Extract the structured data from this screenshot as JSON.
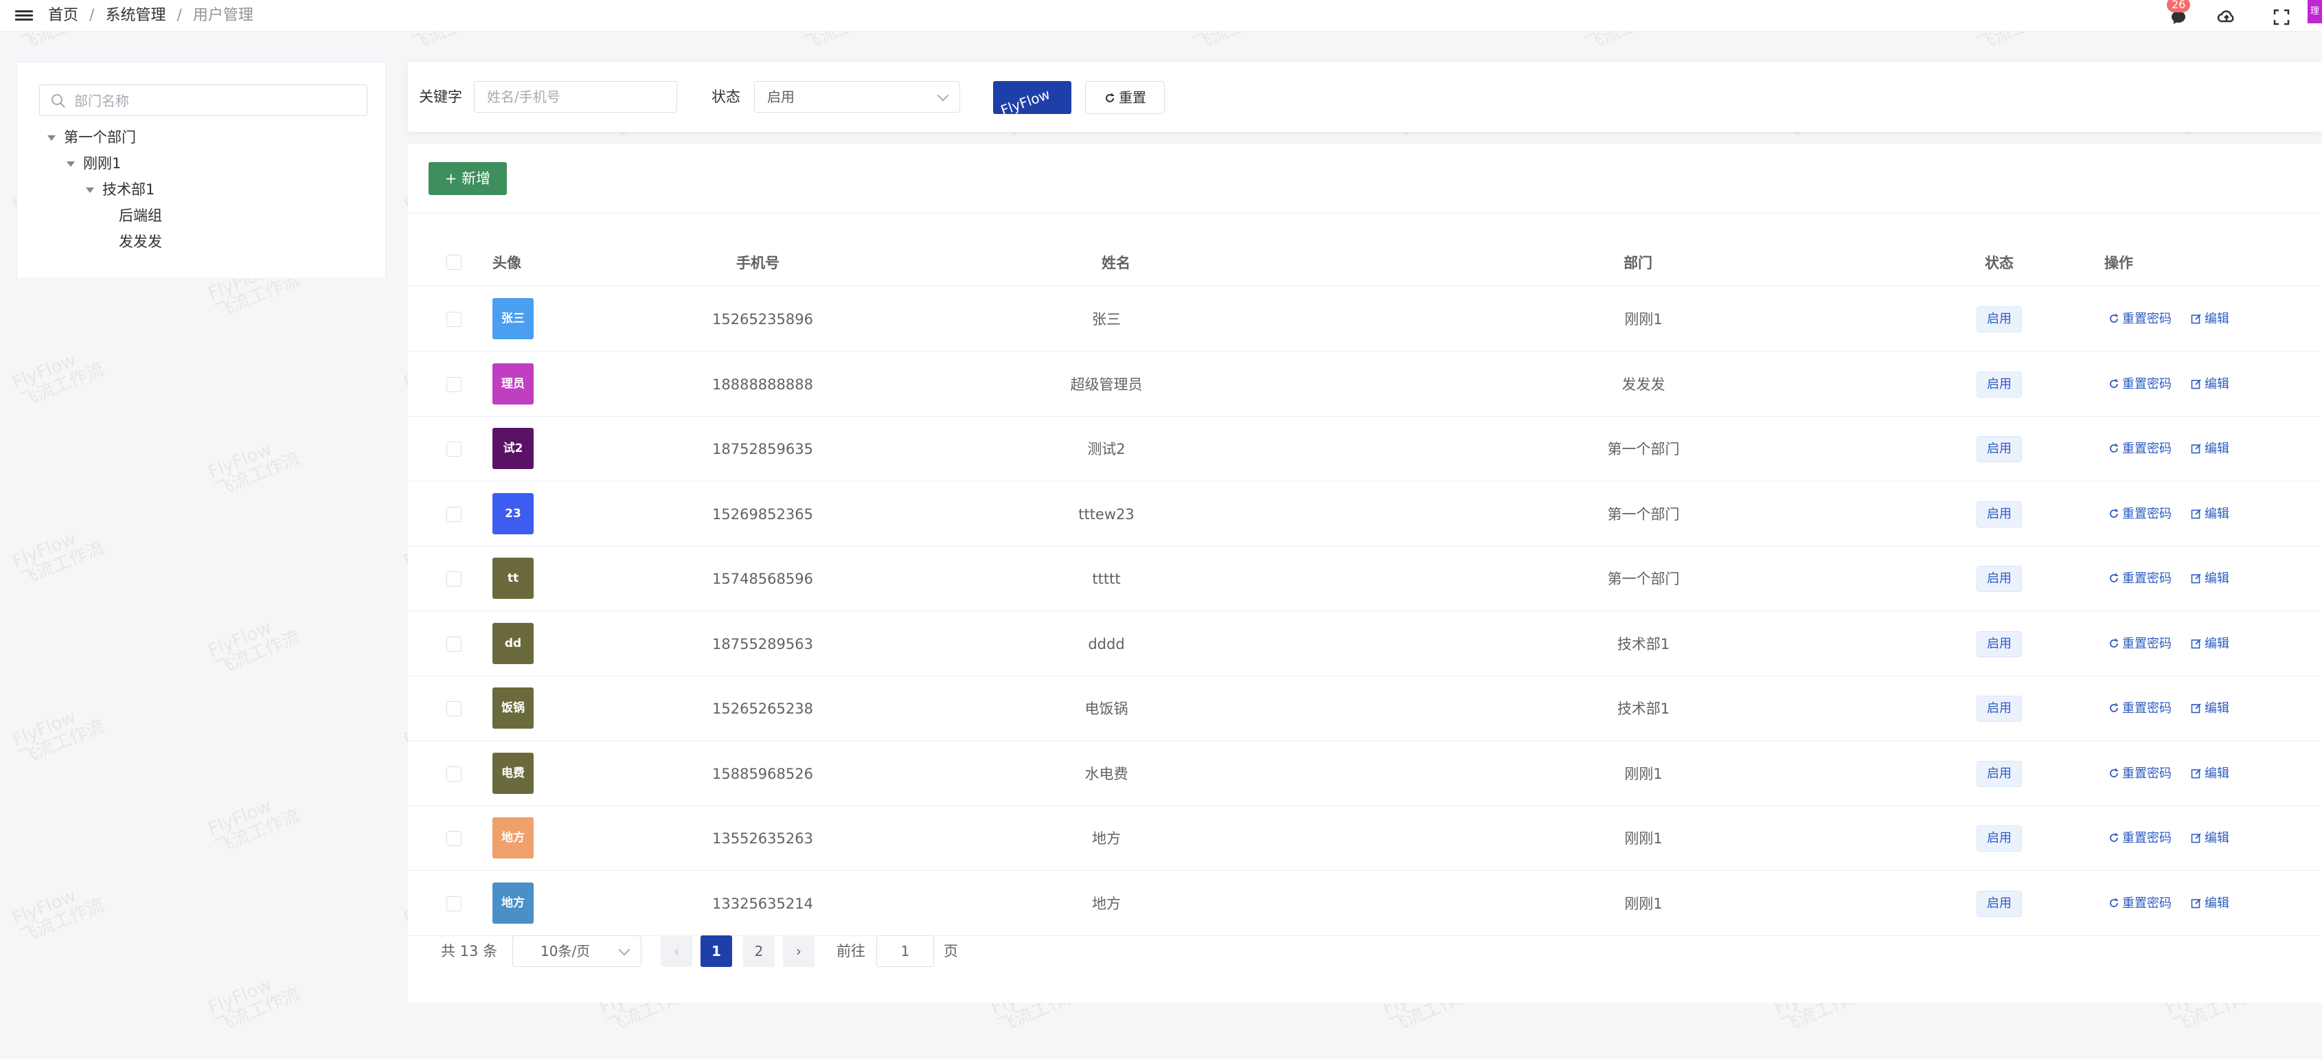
{
  "breadcrumb": {
    "home": "首页",
    "section": "系统管理",
    "current": "用户管理",
    "separator": "/"
  },
  "header": {
    "message_badge": "26",
    "user_initial": "理"
  },
  "tree": {
    "search_placeholder": "部门名称",
    "nodes": [
      {
        "label": "第一个部门",
        "level": 0,
        "expanded": true
      },
      {
        "label": "刚刚1",
        "level": 1,
        "expanded": true
      },
      {
        "label": "技术部1",
        "level": 2,
        "expanded": true
      },
      {
        "label": "后端组",
        "level": 3,
        "expanded": false
      },
      {
        "label": "发发发",
        "level": 3,
        "expanded": false
      }
    ]
  },
  "filter": {
    "keyword_label": "关键字",
    "keyword_placeholder": "姓名/手机号",
    "status_label": "状态",
    "status_value": "启用",
    "reset_label": "重置"
  },
  "toolbar": {
    "add_label": "新增"
  },
  "table": {
    "headers": {
      "avatar": "头像",
      "phone": "手机号",
      "name": "姓名",
      "dept": "部门",
      "status": "状态",
      "actions": "操作"
    },
    "reset_password_label": "重置密码",
    "edit_label": "编辑",
    "rows": [
      {
        "avatar": "张三",
        "avatar_color": "#4a9ff0",
        "phone": "15265235896",
        "name": "张三",
        "dept": "刚刚1",
        "status": "启用"
      },
      {
        "avatar": "理员",
        "avatar_color": "#c03fc0",
        "phone": "18888888888",
        "name": "超级管理员",
        "dept": "发发发",
        "status": "启用"
      },
      {
        "avatar": "试2",
        "avatar_color": "#5a1267",
        "phone": "18752859635",
        "name": "测试2",
        "dept": "第一个部门",
        "status": "启用"
      },
      {
        "avatar": "23",
        "avatar_color": "#3d5cf0",
        "phone": "15269852365",
        "name": "tttew23",
        "dept": "第一个部门",
        "status": "启用"
      },
      {
        "avatar": "tt",
        "avatar_color": "#6a6a3c",
        "phone": "15748568596",
        "name": "ttttt",
        "dept": "第一个部门",
        "status": "启用"
      },
      {
        "avatar": "dd",
        "avatar_color": "#6a6a3c",
        "phone": "18755289563",
        "name": "dddd",
        "dept": "技术部1",
        "status": "启用"
      },
      {
        "avatar": "饭锅",
        "avatar_color": "#6a6a3c",
        "phone": "15265265238",
        "name": "电饭锅",
        "dept": "技术部1",
        "status": "启用"
      },
      {
        "avatar": "电费",
        "avatar_color": "#6a6a3c",
        "phone": "15885968526",
        "name": "水电费",
        "dept": "刚刚1",
        "status": "启用"
      },
      {
        "avatar": "地方",
        "avatar_color": "#f0a06a",
        "phone": "13552635263",
        "name": "地方",
        "dept": "刚刚1",
        "status": "启用"
      },
      {
        "avatar": "地方",
        "avatar_color": "#4a8fc8",
        "phone": "13325635214",
        "name": "地方",
        "dept": "刚刚1",
        "status": "启用"
      }
    ]
  },
  "pagination": {
    "total_text": "共 13 条",
    "page_size": "10条/页",
    "pages": [
      "1",
      "2"
    ],
    "current_page": "1",
    "goto_label": "前往",
    "goto_value": "1",
    "page_unit": "页"
  },
  "watermark": {
    "line1": "FlyFlow",
    "line2": "飞流工作流"
  }
}
